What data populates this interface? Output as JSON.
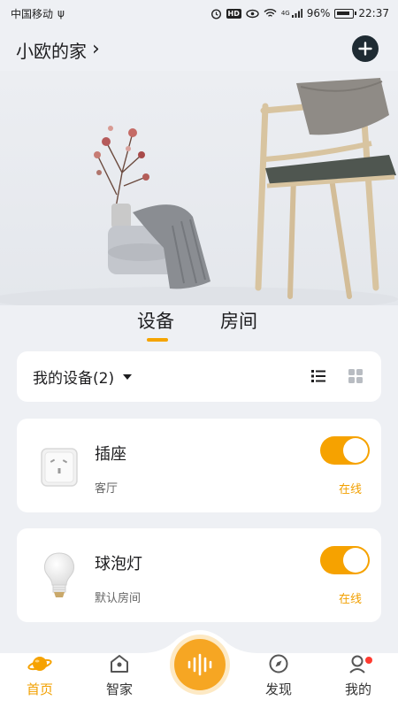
{
  "status_bar": {
    "carrier": "中国移动",
    "usb": "ψ",
    "hd": "HD",
    "signal_tag": "4G",
    "battery": "96%",
    "time": "22:37"
  },
  "header": {
    "home_name": "小欧的家",
    "chevron": "›",
    "add_icon": "plus-circle-icon"
  },
  "tabs": [
    {
      "label": "设备",
      "active": true
    },
    {
      "label": "房间",
      "active": false
    }
  ],
  "device_header": {
    "label": "我的设备(2)"
  },
  "devices": [
    {
      "name": "插座",
      "room": "客厅",
      "status": "在线",
      "on": true,
      "icon": "socket-icon"
    },
    {
      "name": "球泡灯",
      "room": "默认房间",
      "status": "在线",
      "on": true,
      "icon": "bulb-icon"
    }
  ],
  "bottom_nav": [
    {
      "label": "首页",
      "icon": "planet-icon",
      "active": true
    },
    {
      "label": "智家",
      "icon": "house-icon",
      "active": false
    },
    {
      "label": "发现",
      "icon": "compass-icon",
      "active": false
    },
    {
      "label": "我的",
      "icon": "profile-icon",
      "active": false
    }
  ],
  "colors": {
    "accent": "#f6a200",
    "background": "#eef0f4",
    "dark_button": "#1f2b33"
  }
}
